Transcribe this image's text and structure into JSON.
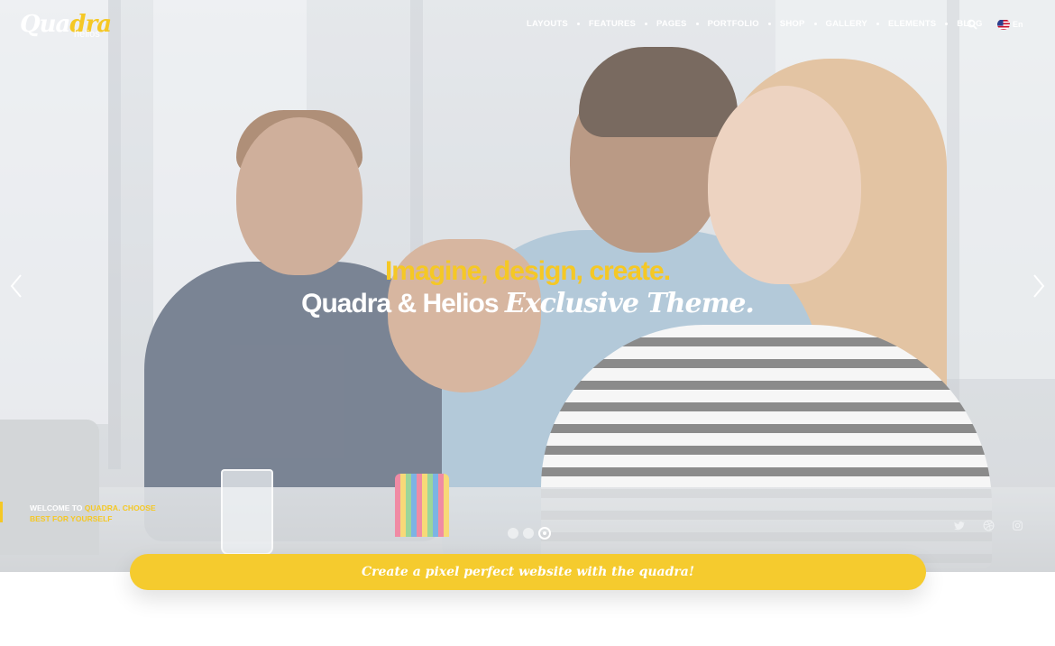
{
  "logo": {
    "main": "Quadra",
    "main_plain": "Qua",
    "main_accent": "dra",
    "sub": "helios"
  },
  "nav": {
    "items": [
      {
        "label": "LAYOUTS"
      },
      {
        "label": "FEATURES"
      },
      {
        "label": "PAGES"
      },
      {
        "label": "PORTFOLIO"
      },
      {
        "label": "SHOP"
      },
      {
        "label": "GALLERY"
      },
      {
        "label": "ELEMENTS"
      },
      {
        "label": "BLOG"
      }
    ],
    "search_icon": "search-icon",
    "language": {
      "label": "En",
      "flag_icon": "us-flag-icon"
    }
  },
  "slide": {
    "headline": "Imagine, design, create.",
    "subline_plain": "Quadra & Helios ",
    "subline_italic": "Exclusive Theme."
  },
  "welcome": {
    "part1": "WELCOME TO ",
    "part2": "QUADRA. CHOOSE BEST FOR YOURSELF"
  },
  "slider": {
    "dots": 3,
    "active_index": 2
  },
  "social": {
    "icons": [
      "twitter-icon",
      "dribbble-icon",
      "instagram-icon"
    ]
  },
  "cta": {
    "label": "Create a pixel perfect website with the quadra!"
  },
  "colors": {
    "accent": "#f5c825",
    "cta_bg": "#f5cb2e",
    "text_light": "#ffffff"
  }
}
